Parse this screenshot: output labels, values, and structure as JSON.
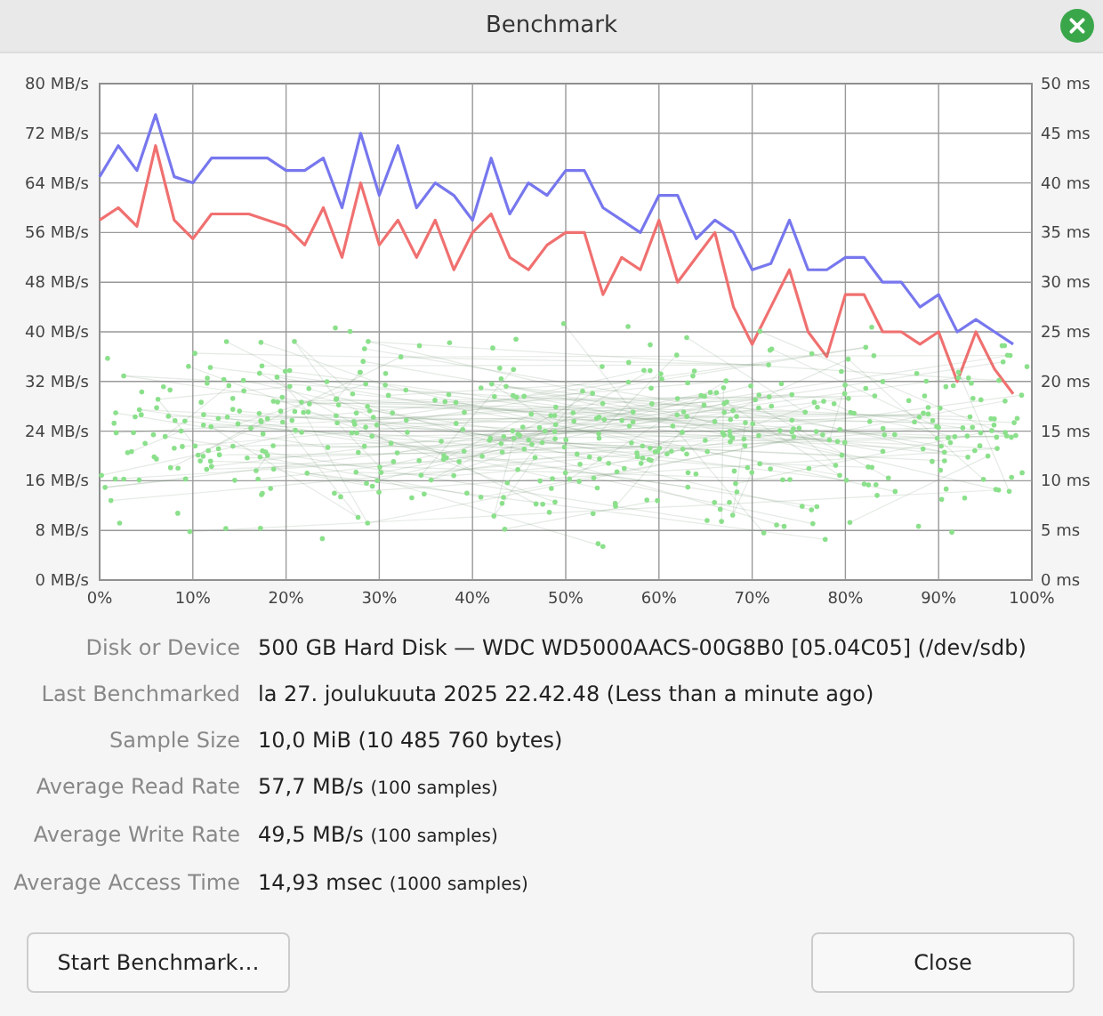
{
  "window": {
    "title": "Benchmark"
  },
  "chart": {
    "chart_data": {
      "type": "line",
      "x": [
        0,
        2,
        4,
        6,
        8,
        10,
        12,
        14,
        16,
        18,
        20,
        22,
        24,
        26,
        28,
        30,
        32,
        34,
        36,
        38,
        40,
        42,
        44,
        46,
        48,
        50,
        52,
        54,
        56,
        58,
        60,
        62,
        64,
        66,
        68,
        70,
        72,
        74,
        76,
        78,
        80,
        82,
        84,
        86,
        88,
        90,
        92,
        94,
        96,
        98
      ],
      "series": [
        {
          "color": "#7777ee",
          "values": [
            65,
            70,
            66,
            75,
            65,
            64,
            68,
            68,
            68,
            68,
            66,
            66,
            68,
            60,
            72,
            62,
            70,
            60,
            64,
            62,
            58,
            68,
            59,
            64,
            62,
            66,
            66,
            60,
            58,
            56,
            62,
            62,
            55,
            58,
            56,
            50,
            51,
            58,
            50,
            50,
            52,
            52,
            48,
            48,
            44,
            46,
            40,
            42,
            40,
            38
          ]
        },
        {
          "color": "#f07070",
          "values": [
            58,
            60,
            57,
            70,
            58,
            55,
            59,
            59,
            59,
            58,
            57,
            54,
            60,
            52,
            64,
            54,
            58,
            52,
            58,
            50,
            56,
            59,
            52,
            50,
            54,
            56,
            56,
            46,
            52,
            50,
            58,
            48,
            52,
            56,
            44,
            38,
            44,
            50,
            40,
            36,
            46,
            46,
            40,
            40,
            38,
            40,
            32,
            40,
            34,
            30
          ]
        }
      ],
      "grid": true,
      "xlim": [
        0,
        100
      ],
      "ylim": [
        0,
        80
      ],
      "xticks": [
        {
          "value": 0,
          "label": "0%"
        },
        {
          "value": 10,
          "label": "10%"
        },
        {
          "value": 20,
          "label": "20%"
        },
        {
          "value": 30,
          "label": "30%"
        },
        {
          "value": 40,
          "label": "40%"
        },
        {
          "value": 50,
          "label": "50%"
        },
        {
          "value": 60,
          "label": "60%"
        },
        {
          "value": 70,
          "label": "70%"
        },
        {
          "value": 80,
          "label": "80%"
        },
        {
          "value": 90,
          "label": "90%"
        },
        {
          "value": 100,
          "label": "100%"
        }
      ],
      "yticks": [
        {
          "value": 0,
          "label": "0 MB/s"
        },
        {
          "value": 8,
          "label": "8 MB/s"
        },
        {
          "value": 16,
          "label": "16 MB/s"
        },
        {
          "value": 24,
          "label": "24 MB/s"
        },
        {
          "value": 32,
          "label": "32 MB/s"
        },
        {
          "value": 40,
          "label": "40 MB/s"
        },
        {
          "value": 48,
          "label": "48 MB/s"
        },
        {
          "value": 56,
          "label": "56 MB/s"
        },
        {
          "value": 64,
          "label": "64 MB/s"
        },
        {
          "value": 72,
          "label": "72 MB/s"
        },
        {
          "value": 80,
          "label": "80 MB/s"
        }
      ]
    },
    "access_time_axis": [
      "50 ms",
      "45 ms",
      "40 ms",
      "35 ms",
      "30 ms",
      "25 ms",
      "20 ms",
      "15 ms",
      "10 ms",
      "5 ms",
      "0 ms"
    ]
  },
  "details": [
    {
      "label": "Disk or Device",
      "value": "500 GB Hard Disk — WDC WD5000AACS-00G8B0 [05.04C05] (/dev/sdb)"
    },
    {
      "label": "Last Benchmarked",
      "value": "la 27. joulukuuta 2025 22.42.48 (Less than a minute ago)"
    },
    {
      "label": "Sample Size",
      "value": "10,0 MiB (10 485 760 bytes)"
    },
    {
      "label": "Average Read Rate",
      "value": "57,7 MB/s",
      "note": "(100 samples)"
    },
    {
      "label": "Average Write Rate",
      "value": "49,5 MB/s",
      "note": "(100 samples)"
    },
    {
      "label": "Average Access Time",
      "value": "14,93 msec",
      "note": "(1000 samples)"
    }
  ],
  "buttons": [
    {
      "label": "Start Benchmark…"
    },
    {
      "label": "Close"
    }
  ]
}
